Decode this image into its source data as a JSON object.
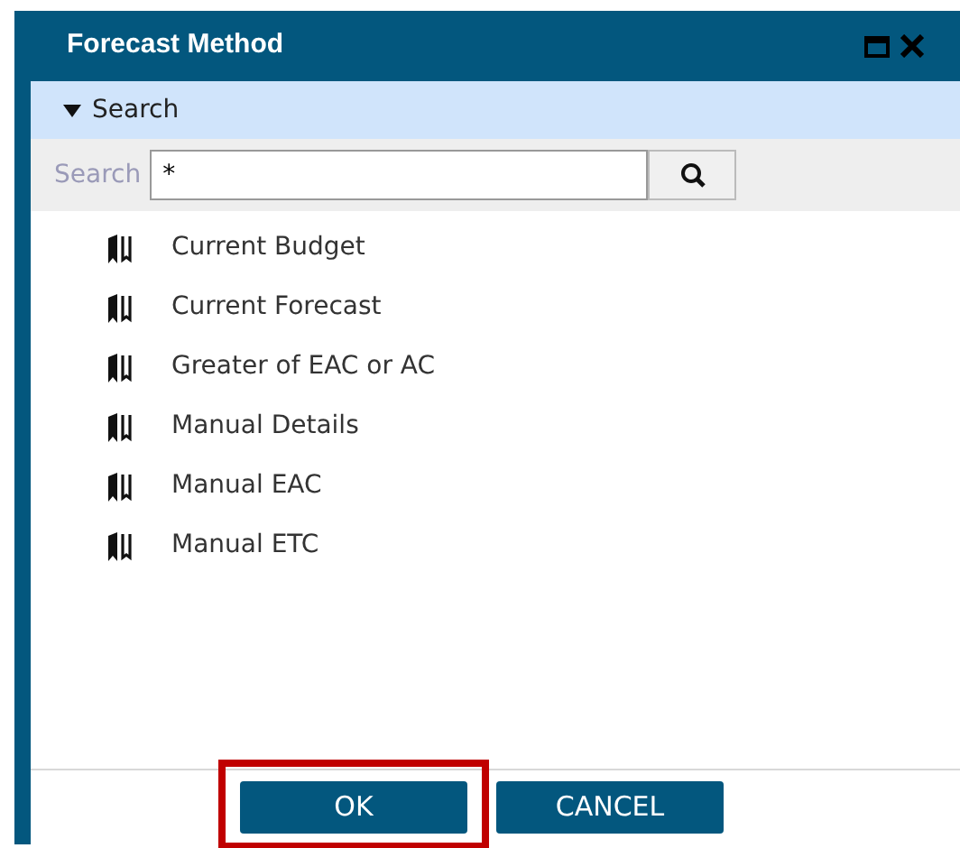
{
  "window": {
    "title": "Forecast Method"
  },
  "search_panel": {
    "header": "Search",
    "expanded": true,
    "label": "Search",
    "value": "*"
  },
  "items": [
    {
      "label": "Current Budget"
    },
    {
      "label": "Current Forecast"
    },
    {
      "label": "Greater of EAC or AC"
    },
    {
      "label": "Manual Details"
    },
    {
      "label": "Manual EAC"
    },
    {
      "label": "Manual ETC"
    }
  ],
  "buttons": [
    {
      "label": "OK",
      "highlighted": true
    },
    {
      "label": "CANCEL",
      "highlighted": false
    }
  ]
}
